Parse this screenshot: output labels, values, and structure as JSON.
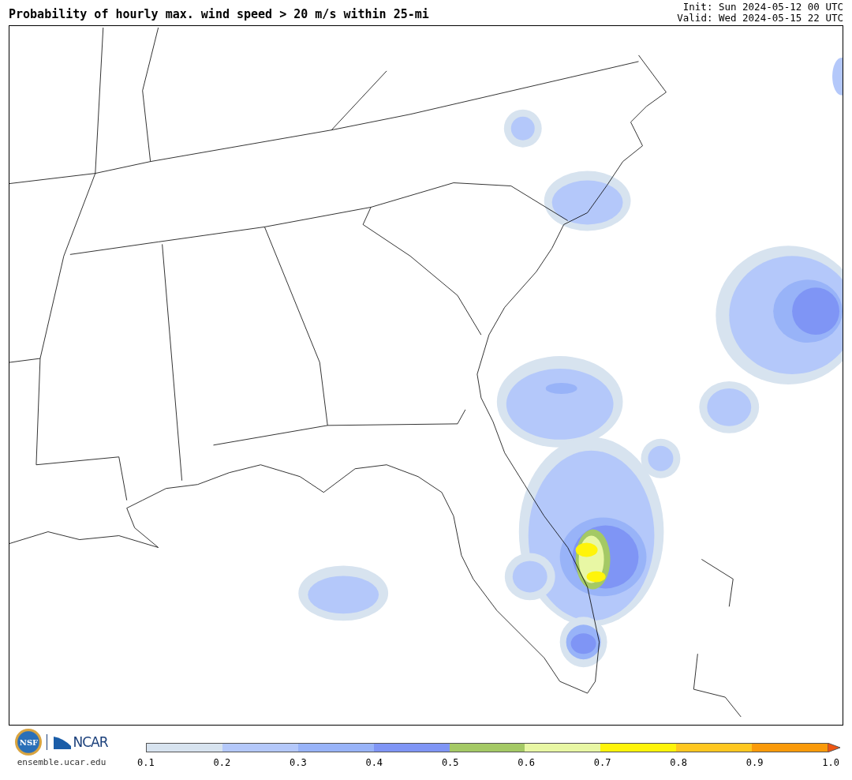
{
  "header": {
    "title": "Probability of hourly max. wind speed > 20 m/s within 25-mi",
    "init": "Init: Sun 2024-05-12 00 UTC",
    "valid": "Valid: Wed 2024-05-15 22 UTC"
  },
  "footer": {
    "nsf_logo": "NSF",
    "ncar_logo": "NCAR",
    "url": "ensemble.ucar.edu"
  },
  "colorbar": {
    "bins": [
      {
        "color": "#d7e3ef"
      },
      {
        "color": "#b4c8fa"
      },
      {
        "color": "#98b3f8"
      },
      {
        "color": "#7f95f5"
      },
      {
        "color": "#a4c965"
      },
      {
        "color": "#e8f7a4"
      },
      {
        "color": "#fff40a"
      },
      {
        "color": "#ffc720"
      },
      {
        "color": "#fa9a0a"
      }
    ],
    "extend_arrow": {
      "color": "#ee5512"
    },
    "ticks": [
      "0.1",
      "0.2",
      "0.3",
      "0.4",
      "0.5",
      "0.6",
      "0.7",
      "0.8",
      "0.9",
      "1.0"
    ]
  }
}
